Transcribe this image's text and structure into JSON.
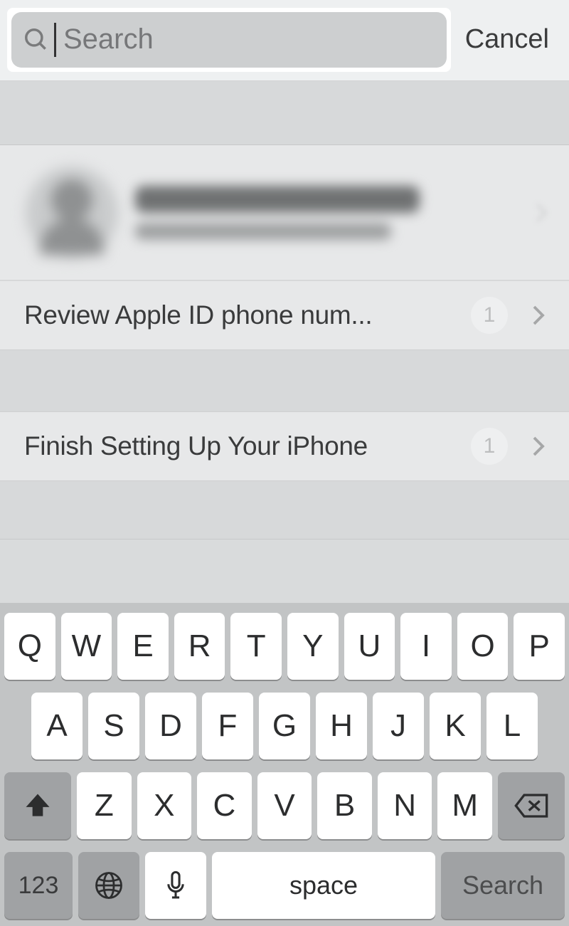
{
  "header": {
    "search_placeholder": "Search",
    "search_value": "",
    "cancel_label": "Cancel"
  },
  "profile": {
    "name_redacted": true,
    "subtitle_redacted": true
  },
  "rows": {
    "review": {
      "label": "Review Apple ID phone num...",
      "badge": "1"
    },
    "finish": {
      "label": "Finish Setting Up Your iPhone",
      "badge": "1"
    }
  },
  "keyboard": {
    "row1": [
      "Q",
      "W",
      "E",
      "R",
      "T",
      "Y",
      "U",
      "I",
      "O",
      "P"
    ],
    "row2": [
      "A",
      "S",
      "D",
      "F",
      "G",
      "H",
      "J",
      "K",
      "L"
    ],
    "row3": [
      "Z",
      "X",
      "C",
      "V",
      "B",
      "N",
      "M"
    ],
    "labels": {
      "numbers": "123",
      "space": "space",
      "search": "Search"
    },
    "icons": {
      "shift": "shift-icon",
      "delete": "delete-icon",
      "globe": "globe-icon",
      "mic": "mic-icon"
    }
  }
}
